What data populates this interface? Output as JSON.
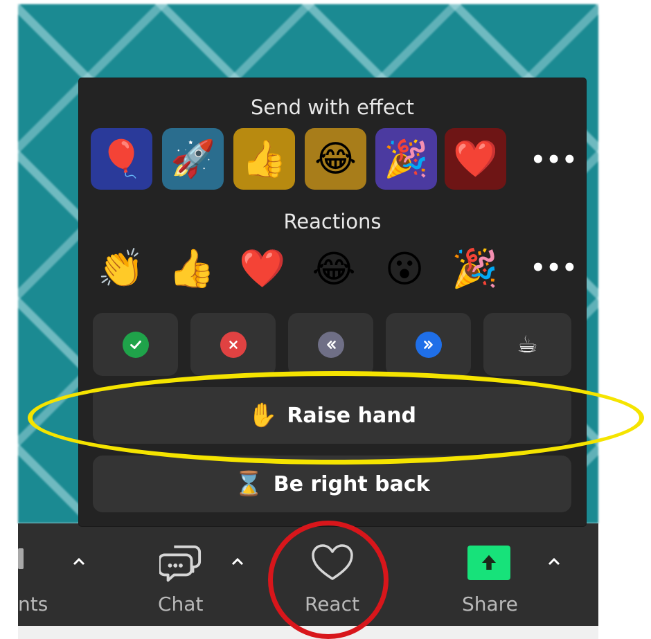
{
  "popup": {
    "effects_title": "Send with effect",
    "effects": [
      {
        "name": "balloon",
        "emoji": "🎈",
        "bg": "#2a3a9a"
      },
      {
        "name": "rocket",
        "emoji": "🚀",
        "bg": "#2a6d8e"
      },
      {
        "name": "thumbs-up",
        "emoji": "👍",
        "bg": "#b88a10"
      },
      {
        "name": "laughing",
        "emoji": "😂",
        "bg": "#a87d1a"
      },
      {
        "name": "party",
        "emoji": "🎉",
        "bg": "#4b3aa0"
      },
      {
        "name": "heart",
        "emoji": "❤️",
        "bg": "#6e1515"
      }
    ],
    "more_label": "•••",
    "reactions_title": "Reactions",
    "reactions": [
      {
        "name": "clapping-hands",
        "emoji": "👏"
      },
      {
        "name": "thumbs-up",
        "emoji": "👍"
      },
      {
        "name": "heart",
        "emoji": "❤️"
      },
      {
        "name": "tears-of-joy",
        "emoji": "😂"
      },
      {
        "name": "surprised",
        "emoji": "😮"
      },
      {
        "name": "party-popper",
        "emoji": "🎉"
      }
    ],
    "feedback": [
      {
        "name": "yes",
        "glyph": "✓",
        "color": "#1fa34a"
      },
      {
        "name": "no",
        "glyph": "✕",
        "color": "#e04242"
      },
      {
        "name": "slow-down",
        "glyph": "‹‹",
        "color": "#6f6f86"
      },
      {
        "name": "speed-up",
        "glyph": "››",
        "color": "#1f6fe8"
      },
      {
        "name": "coffee",
        "glyph": "☕",
        "color": ""
      }
    ],
    "raise_hand": {
      "emoji": "✋",
      "label": "Raise hand"
    },
    "be_right_back": {
      "emoji": "⌛",
      "label": "Be right back"
    }
  },
  "toolbar": {
    "participants_partial": "nts",
    "chat_label": "Chat",
    "react_label": "React",
    "share_label": "Share",
    "share_color": "#17e27a"
  },
  "annotations": {
    "highlight_color": "#f5e400",
    "circle_color": "#d8161b"
  }
}
